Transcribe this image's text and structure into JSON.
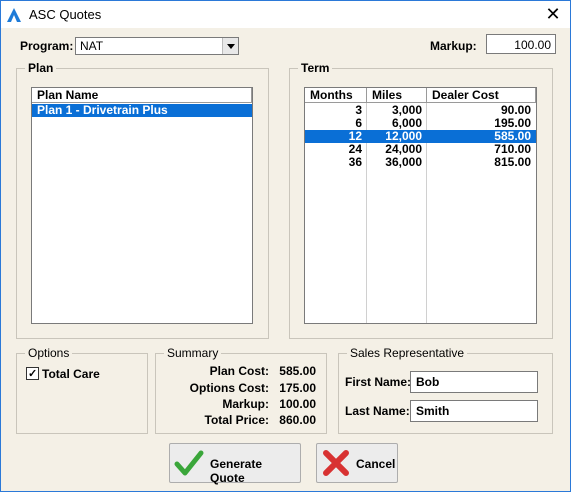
{
  "window": {
    "title": "ASC Quotes"
  },
  "program": {
    "label": "Program:",
    "value": "NAT"
  },
  "markup": {
    "label": "Markup:",
    "value": "100.00"
  },
  "plan": {
    "group_title": "Plan",
    "header": "Plan Name",
    "rows": [
      "Plan 1 - Drivetrain Plus"
    ]
  },
  "term": {
    "group_title": "Term",
    "headers": [
      "Months",
      "Miles",
      "Dealer Cost"
    ],
    "rows": [
      [
        "3",
        "3,000",
        "90.00"
      ],
      [
        "6",
        "6,000",
        "195.00"
      ],
      [
        "12",
        "12,000",
        "585.00"
      ],
      [
        "24",
        "24,000",
        "710.00"
      ],
      [
        "36",
        "36,000",
        "815.00"
      ]
    ],
    "selected_index": 2
  },
  "options": {
    "group_title": "Options",
    "total_care_label": "Total Care",
    "total_care_checked": true
  },
  "summary": {
    "group_title": "Summary",
    "plan_cost_label": "Plan Cost:",
    "plan_cost": "585.00",
    "options_cost_label": "Options Cost:",
    "options_cost": "175.00",
    "markup_label": "Markup:",
    "markup": "100.00",
    "total_price_label": "Total Price:",
    "total_price": "860.00"
  },
  "sales_rep": {
    "group_title": "Sales Representative",
    "first_name_label": "First Name:",
    "first_name": "Bob",
    "last_name_label": "Last Name:",
    "last_name": "Smith"
  },
  "buttons": {
    "generate": "Generate Quote",
    "cancel": "Cancel"
  },
  "colors": {
    "selection": "#0a6fd6",
    "window_bg": "#f4f0e6",
    "window_border": "#2b79d8",
    "ok_green": "#3aa63a",
    "cancel_red": "#d83232"
  }
}
